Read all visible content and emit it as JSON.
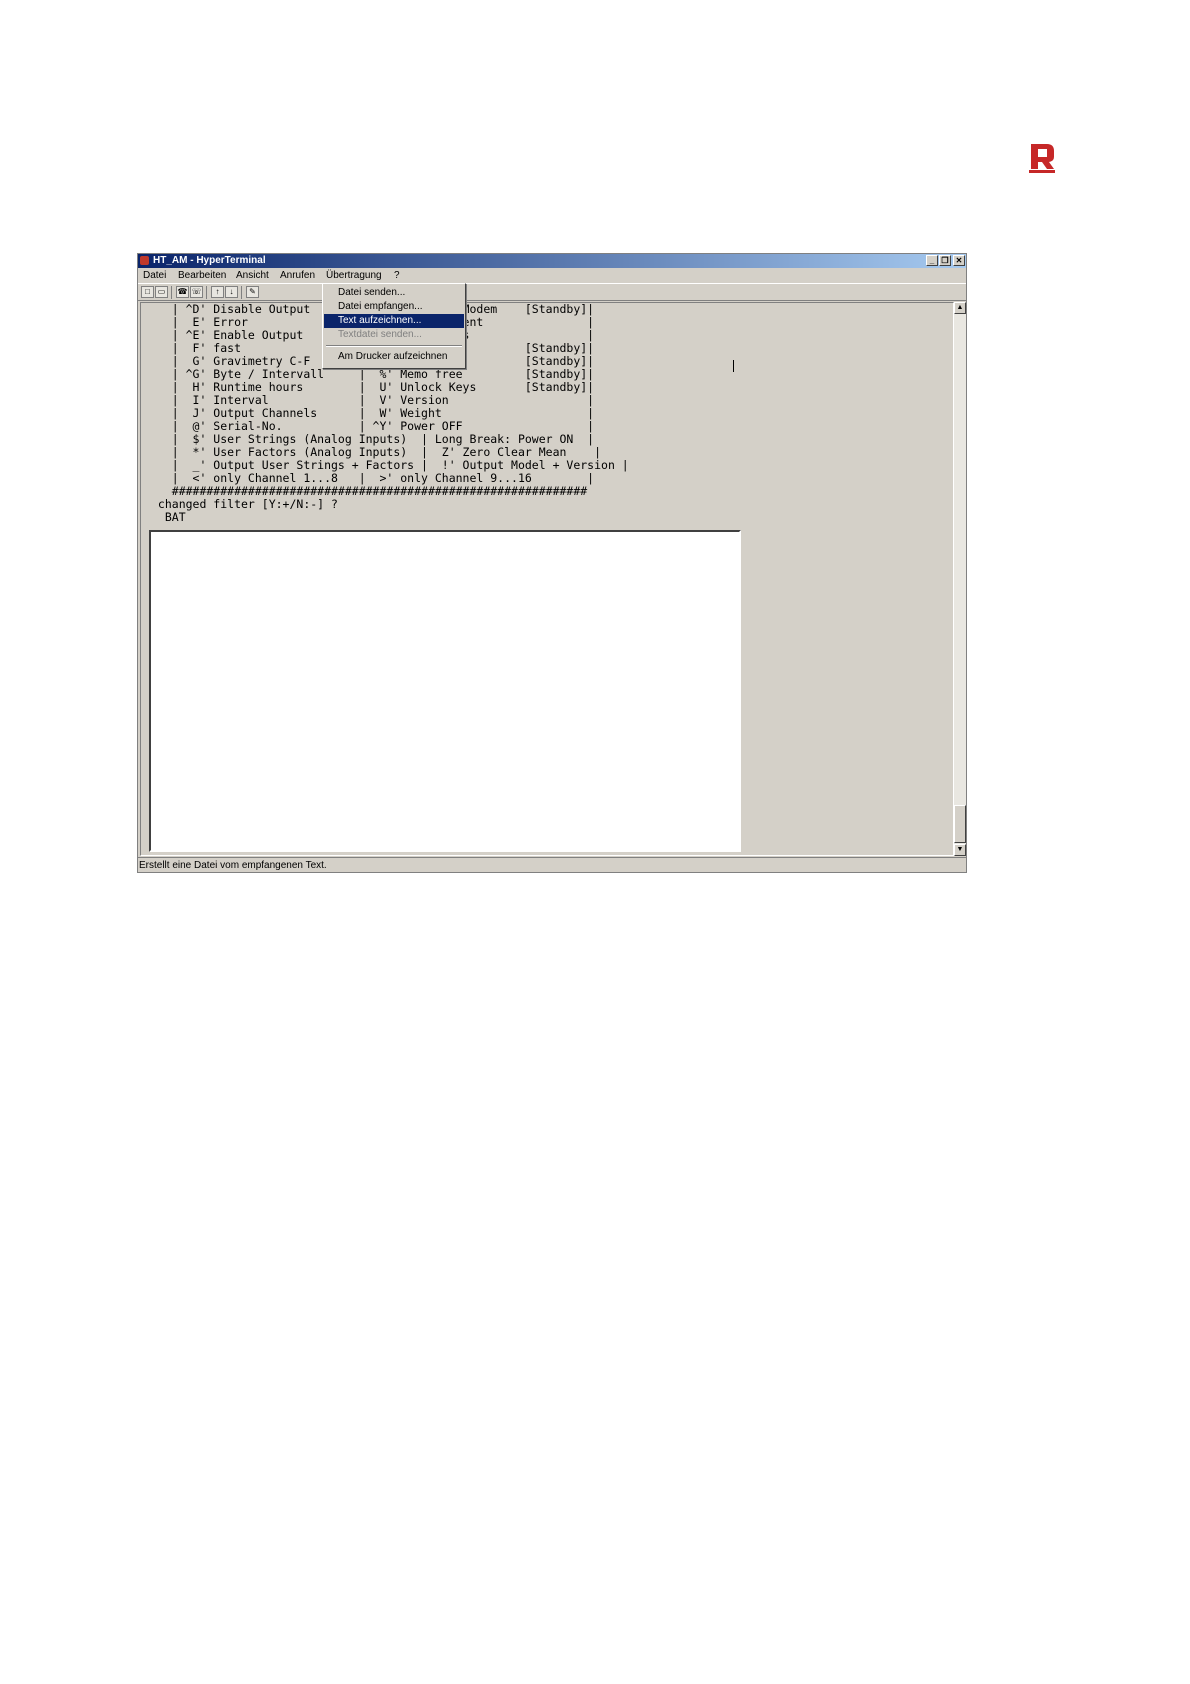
{
  "window": {
    "title": "HT_AM - HyperTerminal",
    "buttons": {
      "minimize": "_",
      "restore": "❐",
      "close": "✕"
    }
  },
  "menubar": [
    "Datei",
    "Bearbeiten",
    "Ansicht",
    "Anrufen",
    "Übertragung",
    "?"
  ],
  "dropdown": {
    "items": [
      "Datei senden...",
      "Datei empfangen...",
      "Text aufzeichnen...",
      "Textdatei senden...",
      "Am Drucker aufzeichnen"
    ],
    "selected": "Text aufzeichnen...",
    "disabled": [
      "Textdatei senden..."
    ]
  },
  "terminal": {
    "lines": [
      "   | ^D' Disable Output          Preferences Modem    [Standby]|",
      "   |  E' Error                   Run Measurement               |",
      "   | ^E' Enable Output           Standby Modus                 |",
      "   |  F' fast                    Timer Set            [Standby]|",
      "   |  G' Gravimetry C-F          Time Set             [Standby]|",
      "   | ^G' Byte / Intervall     |  %' Memo free         [Standby]|",
      "   |  H' Runtime hours        |  U' Unlock Keys       [Standby]|",
      "   |  I' Interval             |  V' Version                    |",
      "   |  J' Output Channels      |  W' Weight                     |",
      "   |  @' Serial-No.           | ^Y' Power OFF                  |",
      "   |  $' User Strings (Analog Inputs)  | Long Break: Power ON  |",
      "   |  *' User Factors (Analog Inputs)  |  Z' Zero Clear Mean    |",
      "   |  _' Output User Strings + Factors |  !' Output Model + Version |",
      "   |  <' only Channel 1...8   |  >' only Channel 9...16        |",
      "   ############################################################",
      " changed filter [Y:+/N:-] ?",
      "  BAT"
    ]
  },
  "status_text": "Erstellt eine Datei vom empfangenen Text.",
  "toolbar_icons": [
    "new-icon",
    "open-icon",
    "connect-icon",
    "disconnect-icon",
    "send-icon",
    "receive-icon",
    "properties-icon"
  ]
}
